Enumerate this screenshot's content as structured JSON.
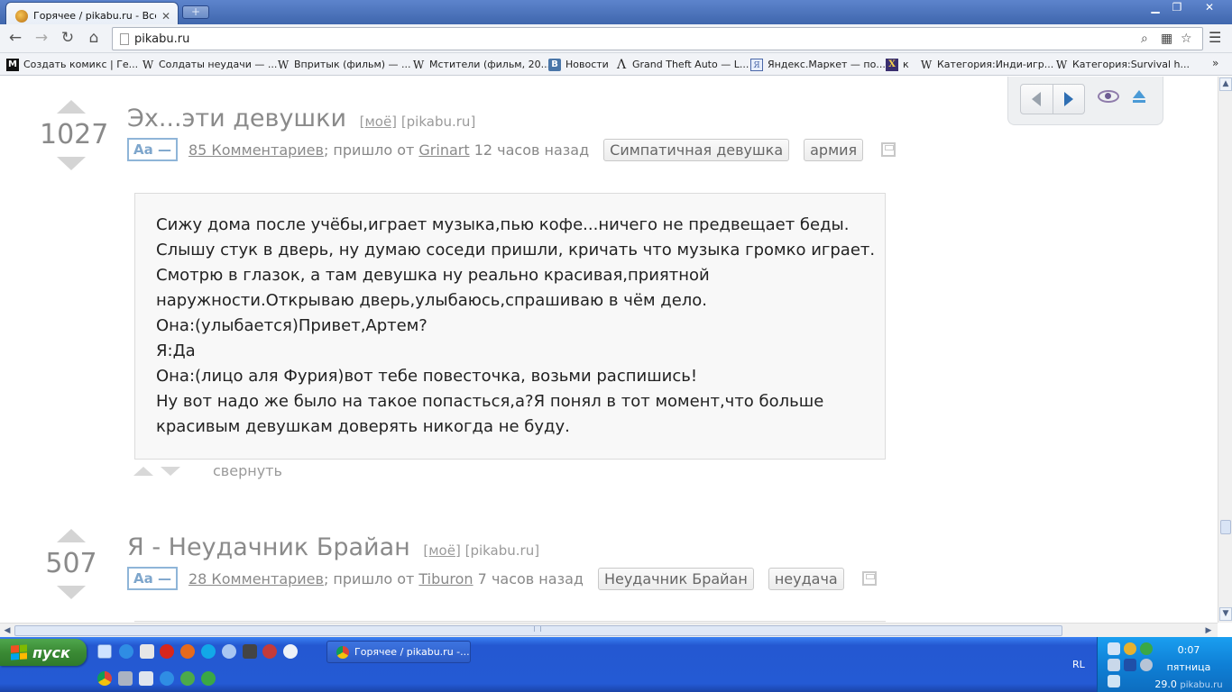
{
  "browser": {
    "tab_title": "Горячее / pikabu.ru - Все",
    "url": "pikabu.ru",
    "bookmarks": [
      {
        "label": "Создать комикс | Ге...",
        "icon": "M"
      },
      {
        "label": "Солдаты неудачи — ...",
        "icon": "W"
      },
      {
        "label": "Впритык (фильм) — ...",
        "icon": "W"
      },
      {
        "label": "Мстители (фильм, 20...",
        "icon": "W"
      },
      {
        "label": "Новости",
        "icon": "B"
      },
      {
        "label": "Grand Theft Auto — L...",
        "icon": "Λ"
      },
      {
        "label": "Яндекс.Маркет — по...",
        "icon": "Я"
      },
      {
        "label": "к",
        "icon": "X"
      },
      {
        "label": "Категория:Инди-игр...",
        "icon": "W"
      },
      {
        "label": "Категория:Survival h...",
        "icon": "W"
      }
    ],
    "bookmarks_more": "»"
  },
  "posts": [
    {
      "score": "1027",
      "title": "Эх...эти девушки",
      "mine": "[моё]",
      "source": "[pikabu.ru]",
      "aa": "Aa —",
      "comments": "85 Комментариев",
      "from_text": "; пришло от",
      "author": "Grinart",
      "time": "12 часов назад",
      "tags": [
        "Симпатичная девушка",
        "армия"
      ],
      "story": [
        "Сижу дома после учёбы,играет музыка,пью кофе...ничего не предвещает беды.",
        "Слышу стук в дверь, ну думаю соседи пришли, кричать что музыка громко играет.",
        "Смотрю в глазок, а там девушка ну реально красивая,приятной",
        "наружности.Открываю дверь,улыбаюсь,спрашиваю в чём дело.",
        "Она:(улыбается)Привет,Артем?",
        "Я:Да",
        "Она:(лицо аля Фурия)вот тебе повесточка, возьми распишись!",
        "Ну вот надо же было на такое попасться,а?Я понял в тот момент,что больше",
        "красивым девушкам доверять никогда не буду."
      ],
      "collapse_label": "свернуть"
    },
    {
      "score": "507",
      "title": "Я - Неудачник Брайан",
      "mine": "[моё]",
      "source": "[pikabu.ru]",
      "aa": "Aa —",
      "comments": "28 Комментариев",
      "from_text": "; пришло от",
      "author": "Tiburon",
      "time": "7 часов назад",
      "tags": [
        "Неудачник Брайан",
        "неудача"
      ]
    }
  ],
  "taskbar": {
    "start_label": "пуск",
    "window_title": "Горячее / pikabu.ru -...",
    "lang": "RL",
    "time": "0:07",
    "day": "пятница",
    "date": "29.0",
    "watermark": "pikabu.ru"
  }
}
